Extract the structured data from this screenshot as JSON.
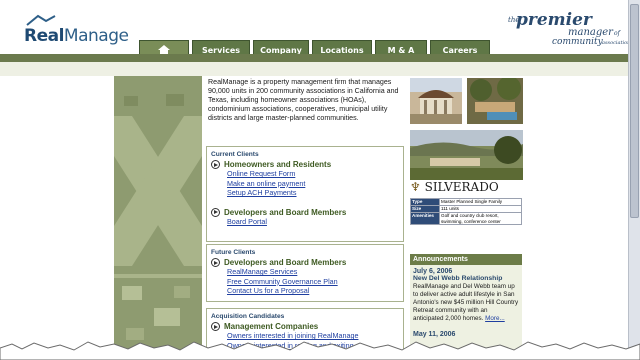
{
  "brand": {
    "logo_text_a": "Real",
    "logo_text_b": "Manage",
    "tagline_the": "the",
    "tagline_premier": "premier",
    "tagline_manager": "manager",
    "tagline_of": "of",
    "tagline_community": "community",
    "tagline_associations": "associations"
  },
  "nav": {
    "items": [
      "Services",
      "Company",
      "Locations",
      "M & A",
      "Careers"
    ]
  },
  "intro": "RealManage is a property management firm that manages 90,000 units in 200 community associations in California and Texas, including homeowner associations (HOAs), condominium associations, cooperatives, municipal utility districts and large master-planned communities.",
  "boxes": {
    "current": {
      "title": "Current Clients",
      "sec1": "Homeowners and Residents",
      "links1": [
        "Online Request Form",
        "Make an online payment",
        "Setup ACH Payments"
      ],
      "sec2": "Developers and Board Members",
      "links2": [
        "Board Portal"
      ]
    },
    "future": {
      "title": "Future Clients",
      "sec1": "Developers and Board Members",
      "links1": [
        "RealManage Services",
        "Free Community Governance Plan",
        "Contact Us for a Proposal"
      ]
    },
    "acq": {
      "title": "Acquisition Candidates",
      "sec1": "Management Companies",
      "links1": [
        "Owners interested in joining RealManage",
        "Owners interested in retiring and exiting"
      ]
    }
  },
  "feature": {
    "name": "SILVERADO",
    "facts": [
      {
        "k": "Type",
        "v": "Master Planned Single Family"
      },
      {
        "k": "Size",
        "v": "111 units"
      },
      {
        "k": "Amenities",
        "v": "Golf and country club resort, swimming, conference center"
      }
    ]
  },
  "announcements": {
    "title": "Announcements",
    "date": "July 6, 2006",
    "headline": "New Del Webb Relationship",
    "body": "RealManage and Del Webb team up to deliver active adult lifestyle in San Antonio's new $45 million Hill Country Retreat community with an anticipated 2,000 homes.",
    "more": "More...",
    "next_date": "May 11, 2006"
  },
  "colors": {
    "nav_green": "#5f7746",
    "panel_green": "#8e9b70",
    "link_blue": "#1f3fa0",
    "heading_navy": "#2b4a6e"
  }
}
